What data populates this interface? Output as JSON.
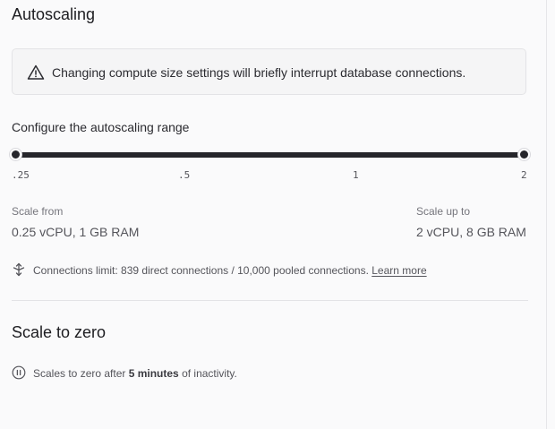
{
  "autoscaling": {
    "title": "Autoscaling",
    "warning": {
      "icon": "warning-triangle-icon",
      "text": "Changing compute size settings will briefly interrupt database connections."
    },
    "range_label": "Configure the autoscaling range",
    "slider": {
      "min_value": 0.25,
      "max_value": 2,
      "ticks": [
        ".25",
        ".5",
        "1",
        "2"
      ]
    },
    "scale_from": {
      "label": "Scale from",
      "value": "0.25 vCPU, 1 GB RAM"
    },
    "scale_up_to": {
      "label": "Scale up to",
      "value": "2 vCPU, 8 GB RAM"
    },
    "connections": {
      "icon": "connections-icon",
      "text": "Connections limit: 839 direct connections / 10,000 pooled connections.",
      "link": "Learn more"
    }
  },
  "scale_to_zero": {
    "title": "Scale to zero",
    "icon": "pause-circle-icon",
    "text_prefix": "Scales to zero after ",
    "text_bold": "5 minutes",
    "text_suffix": " of inactivity."
  },
  "colors": {
    "track": "#26262b",
    "background": "#fafafb",
    "text_muted": "#55555b"
  }
}
